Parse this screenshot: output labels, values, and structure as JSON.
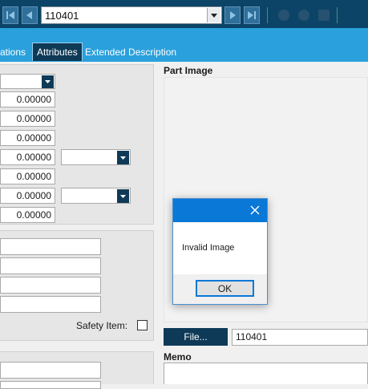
{
  "navigation": {
    "record_value": "110401",
    "buttons": [
      "first-record",
      "previous-record",
      "next-record",
      "last-record"
    ]
  },
  "tabs": [
    {
      "label": "ations",
      "active": false
    },
    {
      "label": "Attributes",
      "active": true
    },
    {
      "label": "Extended Description",
      "active": false
    }
  ],
  "attributes": {
    "values": [
      "0.00000",
      "0.00000",
      "0.00000",
      "0.00000",
      "0.00000",
      "0.00000",
      "0.00000"
    ]
  },
  "safety": {
    "label": "Safety Item:",
    "checked": false
  },
  "part_image": {
    "label": "Part Image",
    "file_button": "File...",
    "file_value": "110401"
  },
  "memo": {
    "label": "Memo"
  },
  "dialog": {
    "message": "Invalid Image",
    "ok_label": "OK"
  },
  "colors": {
    "nav_bg": "#0b4466",
    "tab_bg": "#2aa0dc",
    "active_tab": "#0e3a57",
    "dialog_title": "#0a78d7"
  }
}
